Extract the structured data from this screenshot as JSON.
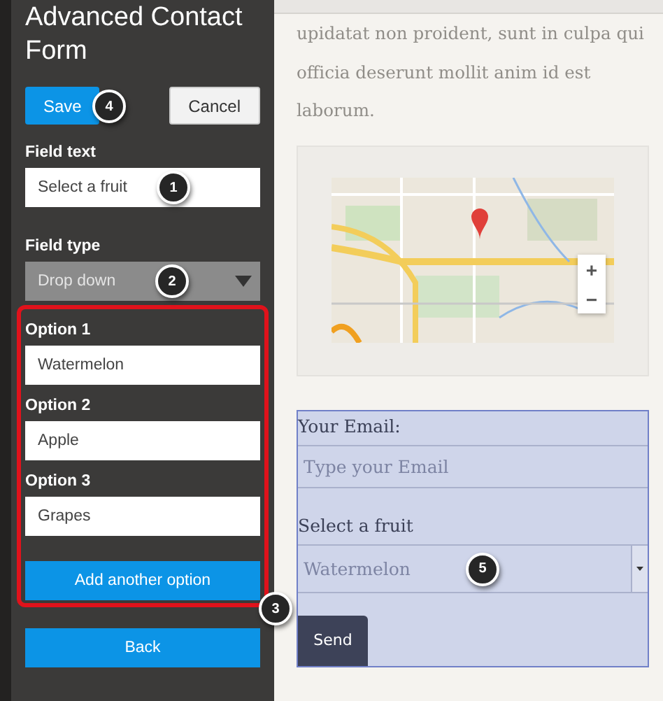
{
  "editor": {
    "title": "Advanced Contact Form",
    "buttons": [
      {
        "label": "Save",
        "kind": "primary",
        "badge": "4"
      },
      {
        "label": "Cancel",
        "kind": "secondary"
      }
    ],
    "field_text": {
      "label": "Field text",
      "value": "Select a fruit",
      "badge": "1"
    },
    "field_type": {
      "label": "Field type",
      "value": "Drop down",
      "badge": "2",
      "disabled": true
    },
    "options": [
      {
        "label": "Option 1",
        "value": "Watermelon"
      },
      {
        "label": "Option 2",
        "value": "Apple"
      },
      {
        "label": "Option 3",
        "value": "Grapes"
      }
    ],
    "add_button": "Add another option",
    "options_badge": "3",
    "back_button": "Back"
  },
  "preview": {
    "paragraph": "upidatat non proident, sunt in culpa qui officia deserunt mollit anim id est laborum.",
    "map": {
      "kind": "picture",
      "zoom_in": "+",
      "zoom_out": "−"
    },
    "form": {
      "email_label": "Your Email:",
      "email_placeholder": "Type your Email",
      "select_label": "Select a fruit",
      "select_value": "Watermelon",
      "select_badge": "5",
      "send": "Send"
    }
  }
}
